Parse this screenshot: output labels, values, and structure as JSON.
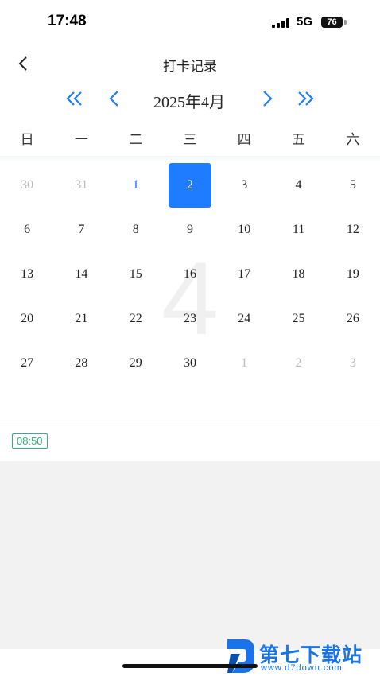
{
  "status_bar": {
    "time": "17:48",
    "network": "5G",
    "battery": "76"
  },
  "nav": {
    "title": "打卡记录",
    "back_icon": "chevron-left-icon"
  },
  "month_selector": {
    "label": "2025年4月",
    "prev_year_icon": "double-chevron-left-icon",
    "prev_month_icon": "chevron-left-icon",
    "next_month_icon": "chevron-right-icon",
    "next_year_icon": "double-chevron-right-icon",
    "accent": "#1f7bff"
  },
  "weekdays": [
    "日",
    "一",
    "二",
    "三",
    "四",
    "五",
    "六"
  ],
  "calendar": {
    "watermark": "4",
    "rows": [
      [
        {
          "d": "30",
          "s": "other"
        },
        {
          "d": "31",
          "s": "other"
        },
        {
          "d": "1",
          "s": "today"
        },
        {
          "d": "2",
          "s": "selected"
        },
        {
          "d": "3",
          "s": ""
        },
        {
          "d": "4",
          "s": ""
        },
        {
          "d": "5",
          "s": ""
        }
      ],
      [
        {
          "d": "6",
          "s": ""
        },
        {
          "d": "7",
          "s": ""
        },
        {
          "d": "8",
          "s": ""
        },
        {
          "d": "9",
          "s": ""
        },
        {
          "d": "10",
          "s": ""
        },
        {
          "d": "11",
          "s": ""
        },
        {
          "d": "12",
          "s": ""
        }
      ],
      [
        {
          "d": "13",
          "s": ""
        },
        {
          "d": "14",
          "s": ""
        },
        {
          "d": "15",
          "s": ""
        },
        {
          "d": "16",
          "s": ""
        },
        {
          "d": "17",
          "s": ""
        },
        {
          "d": "18",
          "s": ""
        },
        {
          "d": "19",
          "s": ""
        }
      ],
      [
        {
          "d": "20",
          "s": ""
        },
        {
          "d": "21",
          "s": ""
        },
        {
          "d": "22",
          "s": ""
        },
        {
          "d": "23",
          "s": ""
        },
        {
          "d": "24",
          "s": ""
        },
        {
          "d": "25",
          "s": ""
        },
        {
          "d": "26",
          "s": ""
        }
      ],
      [
        {
          "d": "27",
          "s": ""
        },
        {
          "d": "28",
          "s": ""
        },
        {
          "d": "29",
          "s": ""
        },
        {
          "d": "30",
          "s": ""
        },
        {
          "d": "1",
          "s": "other"
        },
        {
          "d": "2",
          "s": "other"
        },
        {
          "d": "3",
          "s": "other"
        }
      ]
    ]
  },
  "records": [
    {
      "time": "08:50",
      "color": "#2fb37a"
    }
  ],
  "logo": {
    "name": "第七下载站",
    "url": "www.d7down.com"
  }
}
